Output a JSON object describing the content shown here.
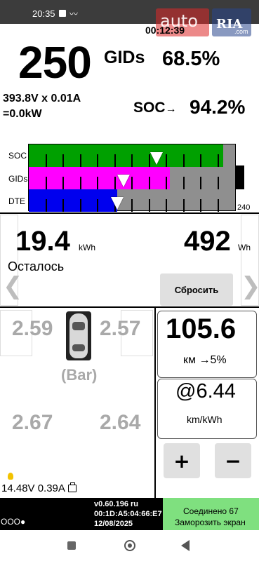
{
  "status": {
    "time": "20:35",
    "timer": "00:12:39",
    "watermark_left": "auto",
    "watermark_right": "RIA",
    "watermark_suffix": ".com"
  },
  "main": {
    "gids": "250",
    "gids_unit": "GIDs",
    "gids_percent": "68.5%",
    "power_line1": "393.8V x 0.01A",
    "power_line2": "=0.0kW",
    "soc_label": "SOC",
    "soc_arrow": "→",
    "soc_value": "94.2%"
  },
  "bars": {
    "labels": [
      "SOC",
      "GIDs",
      "DTE"
    ],
    "max_label": "240",
    "levels": {
      "soc": 0.942,
      "gids": 0.685,
      "dte": 0.43
    },
    "marker_levels": {
      "soc": 0.62,
      "gids": 0.46,
      "dte": 0.43
    },
    "colors": {
      "soc": "#00a000",
      "gids": "#ff00ff",
      "dte": "#0000ee",
      "background": "#8f8f8f"
    }
  },
  "energy": {
    "remaining_value": "19.4",
    "remaining_unit": "kWh",
    "remaining_label": "Осталось",
    "wh_value": "492",
    "wh_unit": "Wh",
    "reset_label": "Сбросить"
  },
  "tires": {
    "front_left": "2.59",
    "front_right": "2.57",
    "rear_left": "2.67",
    "rear_right": "2.64",
    "unit": "(Bar)",
    "aux_battery": "14.48V 0.39A"
  },
  "range": {
    "value": "105.6",
    "unit": "км",
    "arrow": "→",
    "reserve": "5%",
    "efficiency": "@6.44",
    "efficiency_unit": "km/kWh",
    "plus_label": "+",
    "minus_label": "−"
  },
  "footer": {
    "dots": "OOO●",
    "version": "v0.60.196 ru",
    "mac": "00:1D:A5:04:66:E7",
    "date": "12/08/2025",
    "connection": "Соединено 67",
    "freeze": "Заморозить экран",
    "connection_color": "#7fe07f"
  },
  "nav": {
    "icons": [
      "recents-icon",
      "home-icon",
      "back-icon"
    ]
  }
}
